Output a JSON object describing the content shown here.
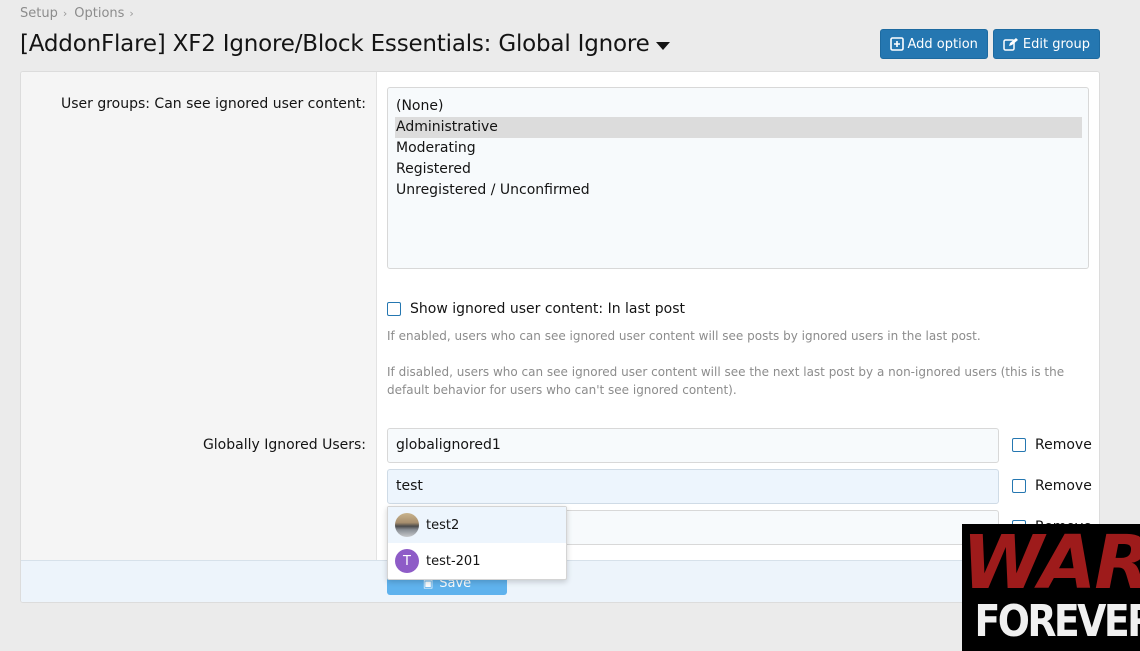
{
  "breadcrumb": [
    "Setup",
    "Options"
  ],
  "page_title": "[AddonFlare] XF2 Ignore/Block Essentials: Global Ignore",
  "buttons": {
    "add_option": "Add option",
    "edit_group": "Edit group",
    "save": "Save"
  },
  "rows": {
    "user_groups": {
      "label": "User groups: Can see ignored user content:",
      "options": [
        "(None)",
        "Administrative",
        "Moderating",
        "Registered",
        "Unregistered / Unconfirmed"
      ],
      "selected": "Administrative"
    },
    "show_ignored": {
      "label": "Show ignored user content: In last post",
      "checked": false,
      "hint_enabled": "If enabled, users who can see ignored user content will see posts by ignored users in the last post.",
      "hint_disabled": "If disabled, users who can see ignored user content will see the next last post by a non-ignored users (this is the default behavior for users who can't see ignored content)."
    },
    "ignored_users": {
      "label": "Globally Ignored Users:",
      "inputs": [
        "globalignored1",
        "test",
        ""
      ],
      "remove_label": "Remove"
    }
  },
  "autocomplete": [
    {
      "name": "test2",
      "avatar": "photo"
    },
    {
      "name": "test-201",
      "avatar": "letter",
      "letter": "T",
      "color": "#8e5cc7"
    }
  ],
  "watermark": {
    "line1": "WAR",
    "line2": "FOREVER"
  },
  "colors": {
    "accent": "#2577b1",
    "save": "#47a7eb",
    "watermark_red": "#9e1b1b"
  }
}
